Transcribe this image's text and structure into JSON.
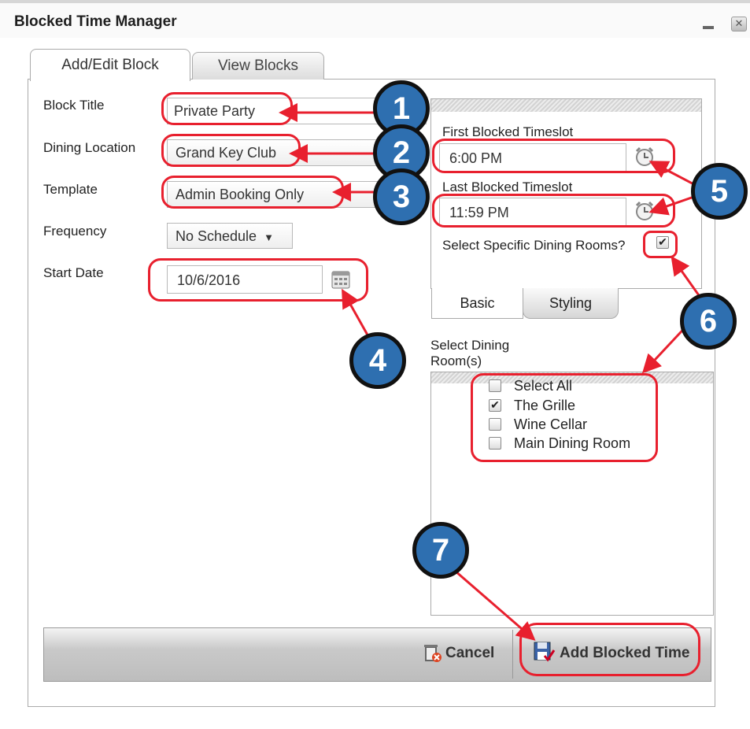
{
  "window": {
    "title": "Blocked Time Manager",
    "minimize_label": "—",
    "close_label": "✕"
  },
  "tabs": [
    {
      "label": "Add/Edit Block"
    },
    {
      "label": "View Blocks"
    }
  ],
  "form": {
    "block_title": {
      "label": "Block Title",
      "value": "Private Party"
    },
    "dining_location": {
      "label": "Dining Location",
      "value": "Grand Key Club"
    },
    "template": {
      "label": "Template",
      "value": "Admin Booking Only"
    },
    "frequency": {
      "label": "Frequency",
      "value": "No Schedule",
      "arrow": "▼"
    },
    "start_date": {
      "label": "Start Date",
      "value": "10/6/2016"
    }
  },
  "timeslots": {
    "first": {
      "label": "First Blocked Timeslot",
      "value": "6:00 PM"
    },
    "last": {
      "label": "Last Blocked Timeslot",
      "value": "11:59 PM"
    },
    "specific_rooms": {
      "label": "Select Specific Dining Rooms?",
      "checked": true
    }
  },
  "subtabs": [
    {
      "label": "Basic"
    },
    {
      "label": "Styling"
    }
  ],
  "rooms": {
    "label_line1": "Select Dining",
    "label_line2": "Room(s)",
    "items": [
      {
        "label": "Select All",
        "checked": false
      },
      {
        "label": "The Grille",
        "checked": true
      },
      {
        "label": "Wine Cellar",
        "checked": false
      },
      {
        "label": "Main Dining Room",
        "checked": false
      }
    ]
  },
  "footer": {
    "cancel_label": "Cancel",
    "add_label": "Add Blocked Time"
  },
  "callouts": [
    "1",
    "2",
    "3",
    "4",
    "5",
    "6",
    "7"
  ],
  "colors": {
    "callout_blue": "#2e6fb0",
    "annotation_red": "#e8202e"
  },
  "icons": [
    "clock-icon",
    "calendar-icon",
    "trash-icon",
    "save-icon",
    "checkbox-icon"
  ]
}
